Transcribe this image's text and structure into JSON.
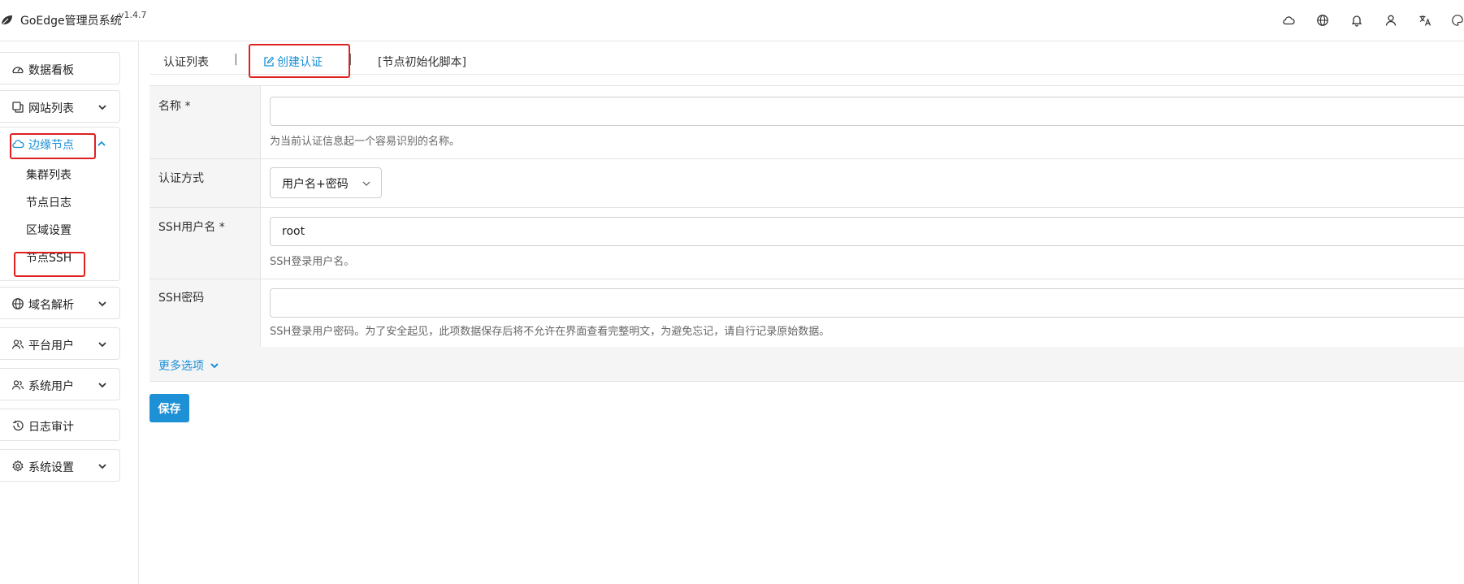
{
  "app": {
    "title": "GoEdge管理员系统",
    "version": "v1.4.7"
  },
  "topbar": {
    "icons": [
      "cloud-icon",
      "globe-icon",
      "bell-icon",
      "user-icon",
      "translate-icon",
      "palette-icon"
    ]
  },
  "sidebar": {
    "items": [
      {
        "label": "数据看板",
        "icon": "dashboard-icon"
      },
      {
        "label": "网站列表",
        "icon": "copy-icon",
        "expandable": true
      },
      {
        "label": "边缘节点",
        "icon": "cloud-icon",
        "expanded": true,
        "children": [
          {
            "label": "集群列表"
          },
          {
            "label": "节点日志"
          },
          {
            "label": "区域设置"
          },
          {
            "label": "节点SSH"
          }
        ]
      },
      {
        "label": "域名解析",
        "icon": "globe-icon",
        "expandable": true
      },
      {
        "label": "平台用户",
        "icon": "users-icon",
        "expandable": true
      },
      {
        "label": "系统用户",
        "icon": "users-icon",
        "expandable": true
      },
      {
        "label": "日志审计",
        "icon": "history-icon"
      },
      {
        "label": "系统设置",
        "icon": "gear-icon",
        "expandable": true
      }
    ]
  },
  "tabs": [
    {
      "label": "认证列表"
    },
    {
      "label": "创建认证",
      "active": true
    },
    {
      "label": "[节点初始化脚本]"
    }
  ],
  "tab_separator": "|",
  "form": {
    "name": {
      "label": "名称 *",
      "value": "",
      "hint": "为当前认证信息起一个容易识别的名称。"
    },
    "auth_method": {
      "label": "认证方式",
      "selected": "用户名+密码"
    },
    "ssh_user": {
      "label": "SSH用户名 *",
      "value": "root",
      "hint": "SSH登录用户名。"
    },
    "ssh_password": {
      "label": "SSH密码",
      "value": "",
      "hint": "SSH登录用户密码。为了安全起见，此项数据保存后将不允许在界面查看完整明文，为避免忘记，请自行记录原始数据。"
    },
    "more_options": "更多选项"
  },
  "buttons": {
    "save": "保存"
  },
  "colors": {
    "accent": "#1a8fd6",
    "highlight_box": "#e02020",
    "label_bg": "#f5f5f5"
  }
}
